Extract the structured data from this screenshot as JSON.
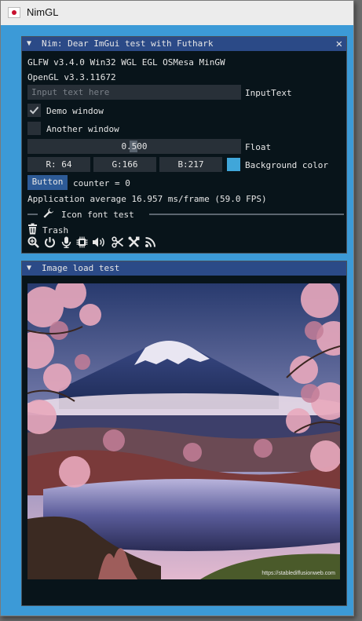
{
  "app": {
    "title": "NimGL"
  },
  "panel1": {
    "title": "Nim: Dear ImGui test with Futhark",
    "collapse": "▼",
    "close": "✕",
    "line1": "GLFW v3.4.0 Win32 WGL EGL OSMesa MinGW",
    "line2": "OpenGL v3.3.11672",
    "input": {
      "placeholder": "Input text here",
      "label": "InputText"
    },
    "demo_window": {
      "label": "Demo window",
      "checked": true
    },
    "another_window": {
      "label": "Another window",
      "checked": false
    },
    "slider": {
      "value": "0.500",
      "label": "Float",
      "fraction": 0.5
    },
    "color": {
      "r": "R: 64",
      "g": "G:166",
      "b": "B:217",
      "label": "Background color",
      "swatch": "#40a6d9"
    },
    "button": {
      "label": "Button",
      "counter": "counter = 0"
    },
    "fps": "Application average 16.957 ms/frame (59.0 FPS)",
    "separator": "Icon font test",
    "trash": "Trash",
    "icon_names": [
      "magnify-plus-icon",
      "power-icon",
      "microphone-icon",
      "chip-icon",
      "volume-icon",
      "scissors-icon",
      "tools-icon",
      "rss-icon"
    ]
  },
  "panel2": {
    "title": "Image load test",
    "collapse": "▼",
    "watermark": "https://stablediffusionweb.com"
  },
  "colors": {
    "window": "#3c9ad7",
    "panel_bg": "#08141a",
    "titlebar": "#2b4a87",
    "frame": "#283038",
    "button": "#2d5a96"
  }
}
